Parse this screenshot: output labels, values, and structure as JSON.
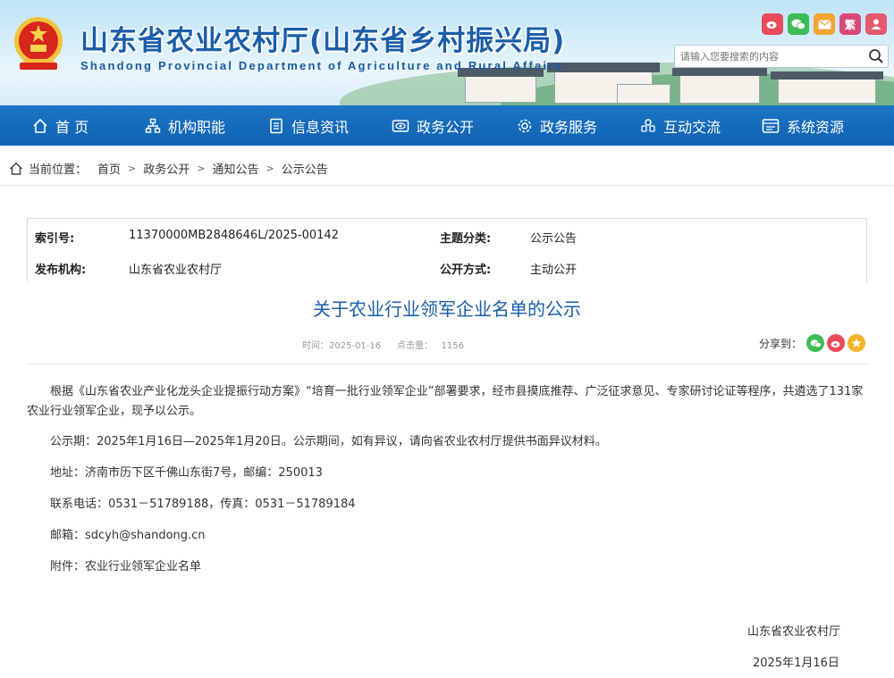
{
  "header": {
    "title": "山东省农业农村厅(山东省乡村振兴局)",
    "subtitle": "Shandong Provincial Department of Agriculture and Rural Affairs",
    "social": [
      {
        "name": "weibo-icon",
        "color": "#e94b5b"
      },
      {
        "name": "wechat-icon",
        "color": "#3dbb54"
      },
      {
        "name": "mail-icon",
        "color": "#f2a530"
      },
      {
        "name": "traditional-chinese-icon",
        "label": "繁",
        "color": "#d9487b"
      },
      {
        "name": "user-icon",
        "color": "#e45a6c"
      }
    ],
    "search_placeholder": "请输入您要搜索的内容"
  },
  "nav": [
    {
      "label": "首 页",
      "icon": "home-icon"
    },
    {
      "label": "机构职能",
      "icon": "org-chart-icon"
    },
    {
      "label": "信息资讯",
      "icon": "document-icon"
    },
    {
      "label": "政务公开",
      "icon": "eye-icon"
    },
    {
      "label": "政务服务",
      "icon": "gear-icon"
    },
    {
      "label": "互动交流",
      "icon": "chat-icon"
    },
    {
      "label": "系统资源",
      "icon": "system-icon"
    }
  ],
  "breadcrumb": {
    "label": "当前位置：",
    "items": [
      "首页",
      "政务公开",
      "通知公告",
      "公示公告"
    ]
  },
  "meta": {
    "index_key": "索引号:",
    "index_value": "11370000MB2848646L/2025-00142",
    "topic_key": "主题分类:",
    "topic_value": "公示公告",
    "publisher_key": "发布机构:",
    "publisher_value": "山东省农业农村厅",
    "open_key": "公开方式:",
    "open_value": "主动公开"
  },
  "article": {
    "title": "关于农业行业领军企业名单的公示",
    "time_label": "时间：",
    "time_value": "2025-01-16",
    "clicks_label": "点击量：",
    "clicks_value": "1156",
    "share_label": "分享到：",
    "paragraphs": [
      "根据《山东省农业产业化龙头企业提振行动方案》“培育一批行业领军企业”部署要求，经市县摸底推荐、广泛征求意见、专家研讨论证等程序，共遴选了131家农业行业领军企业，现予以公示。",
      "公示期：2025年1月16日—2025年1月20日。公示期间，如有异议，请向省农业农村厅提供书面异议材料。",
      "地址：济南市历下区千佛山东街7号，邮编：250013",
      "联系电话：0531－51789188，传真：0531－51789184",
      "邮箱：sdcyh@shandong.cn",
      "附件：农业行业领军企业名单"
    ],
    "signature": "山东省农业农村厅",
    "date": "2025年1月16日"
  },
  "colors": {
    "nav_bg": "#1468b8",
    "title_blue": "#1a5ea8"
  }
}
